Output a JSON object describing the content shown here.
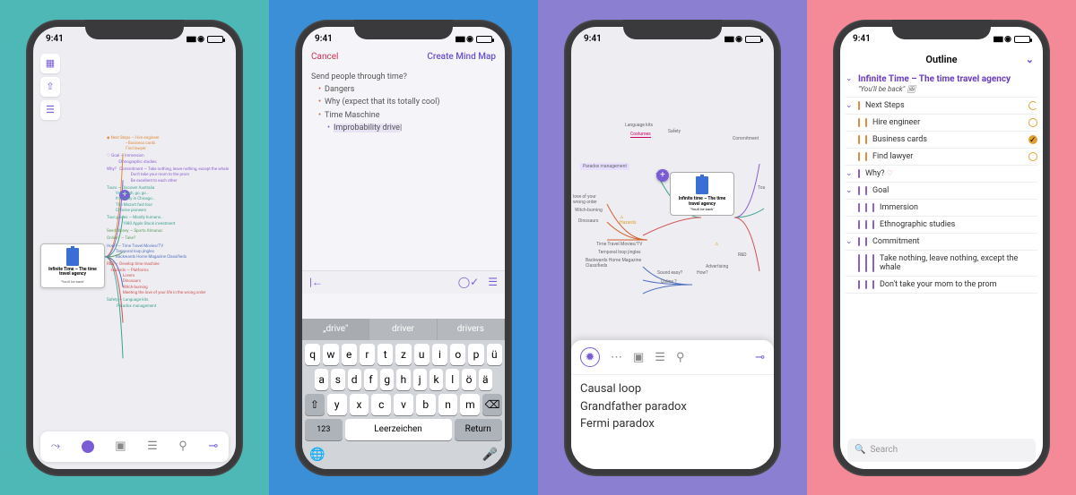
{
  "status": {
    "time": "9:41"
  },
  "s1": {
    "card": {
      "title": "Infinite Time – The time travel agency",
      "sub": "\"You'll be back\""
    },
    "branches": {
      "next_steps": "Next Steps",
      "ns_items": [
        "Hire engineer",
        "Business cards",
        "Find lawyer"
      ],
      "goal": "Goal",
      "goal_items": [
        "Immersion",
        "Ethnographic studies"
      ],
      "why": "Why?",
      "commitment": "Commitment",
      "commit_items": [
        "Take nothing, leave nothing, except the whale",
        "Don't take your mom to the prom",
        "Be excellent to each other"
      ],
      "tours": "Tours",
      "tour_items": [
        "Discover Australia",
        "Van Gogh, go, go...",
        "It's windy in Chicago...",
        "The Mozart fast tour",
        "Chrome pioneers"
      ],
      "tour_guides": "Tour guides",
      "tg_items": [
        "Mostly humans...",
        "1980 Apple Stock investment"
      ],
      "seed_money": "Seed Money",
      "sm_items": [
        "Sports Almanac"
      ],
      "online": "Online?",
      "online_items": [
        "Take?"
      ],
      "how": "How?",
      "how_items": [
        "Time Travel Movies/TV",
        "Temporal loop jingles",
        "Backwards Home Magazine Classifieds"
      ],
      "rd": "R&D",
      "rd_items": [
        "Develop time machine"
      ],
      "hazards": "Hazards",
      "hz_items": [
        "Platforms",
        "Lovers",
        "Dinosaurs",
        "Witch-burning",
        "Meeting the love of your life in the wrong order"
      ],
      "safety": "Safety",
      "sf_items": [
        "Language kits",
        "Paradox management"
      ]
    }
  },
  "s2": {
    "cancel": "Cancel",
    "create": "Create Mind Map",
    "root": "Send people through time?",
    "items": [
      "Dangers",
      "Why (expect that its totally cool)",
      "Time Maschine"
    ],
    "sub": "Improbability drive",
    "sug": [
      "„drive\"",
      "driver",
      "drivers"
    ],
    "rows": [
      [
        "q",
        "w",
        "e",
        "r",
        "t",
        "z",
        "u",
        "i",
        "o",
        "p",
        "ü"
      ],
      [
        "a",
        "s",
        "d",
        "f",
        "g",
        "h",
        "j",
        "k",
        "l",
        "ö",
        "ä"
      ],
      [
        "⇧",
        "y",
        "x",
        "c",
        "v",
        "b",
        "n",
        "m",
        "⌫"
      ]
    ],
    "k123": "123",
    "space": "Leerzeichen",
    "return": "Return"
  },
  "s3": {
    "labels": {
      "language": "Language kits",
      "costumes": "Costumes",
      "safety": "Safety",
      "commitment": "Commitment",
      "paradox": "Paradox management",
      "tou": "Tou",
      "love": "love of your\nwrong order",
      "witch": "Witch-burning",
      "dino": "Dinosaurs",
      "hazards": "Hazards",
      "rd": "R&D",
      "adv": "Advertising",
      "how": "How?",
      "ttmtv": "Time Travel Movies/TV",
      "temporal": "Temporal loop jingles",
      "bhmc": "Backwards Home Magazine\nClassifieds",
      "sound": "Sound easy?",
      "online": "Online ?"
    },
    "card": {
      "title": "Infinite time – The time travel agency",
      "sub": "\"You'll be back\""
    },
    "suggestions": [
      "Causal loop",
      "Grandfather paradox",
      "Fermi paradox"
    ]
  },
  "s4": {
    "header": "Outline",
    "title": "Infinite Time – The time travel agency",
    "sub": "\"You'll be back\"",
    "next_steps": "Next Steps",
    "ns": [
      "Hire engineer",
      "Business cards",
      "Find lawyer"
    ],
    "why": "Why?",
    "goal": "Goal",
    "goal_items": [
      "Immersion",
      "Ethnographic studies"
    ],
    "commitment": "Commitment",
    "commit_items": [
      "Take nothing, leave nothing, except the whale",
      "Don't take your mom to the prom"
    ],
    "search": "Search"
  }
}
